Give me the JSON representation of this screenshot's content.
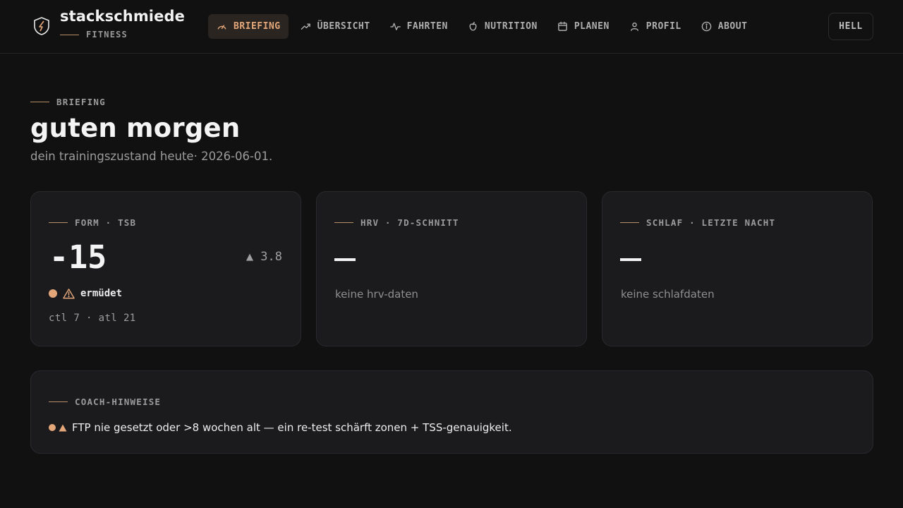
{
  "brand": {
    "name": "stackschmiede",
    "sub": "FITNESS"
  },
  "nav": [
    {
      "label": "BRIEFING",
      "icon": "gauge-icon",
      "active": true
    },
    {
      "label": "ÜBERSICHT",
      "icon": "trending-up-icon"
    },
    {
      "label": "FAHRTEN",
      "icon": "activity-icon"
    },
    {
      "label": "NUTRITION",
      "icon": "apple-icon"
    },
    {
      "label": "PLANEN",
      "icon": "calendar-icon"
    },
    {
      "label": "PROFIL",
      "icon": "user-icon"
    },
    {
      "label": "ABOUT",
      "icon": "info-icon"
    }
  ],
  "theme_toggle": "HELL",
  "page": {
    "eyebrow": "BRIEFING",
    "title": "guten morgen",
    "subtitle": "dein trainingszustand heute· 2026-06-01."
  },
  "cards": {
    "form": {
      "label": "FORM · TSB",
      "value": "-15",
      "delta": "▲ 3.8",
      "status": "ermüdet",
      "meta": "ctl 7 · atl 21"
    },
    "hrv": {
      "label": "HRV · 7D-SCHNITT",
      "empty": "keine hrv-daten"
    },
    "sleep": {
      "label": "SCHLAF · LETZTE NACHT",
      "empty": "keine schlafdaten"
    }
  },
  "coach": {
    "label": "COACH-HINWEISE",
    "hints": [
      "FTP nie gesetzt oder >8 wochen alt — ein re-test schärft zonen + TSS-genauigkeit."
    ]
  },
  "colors": {
    "accent": "#e4a77a",
    "background": "#111112",
    "card": "#1b1b1e"
  }
}
